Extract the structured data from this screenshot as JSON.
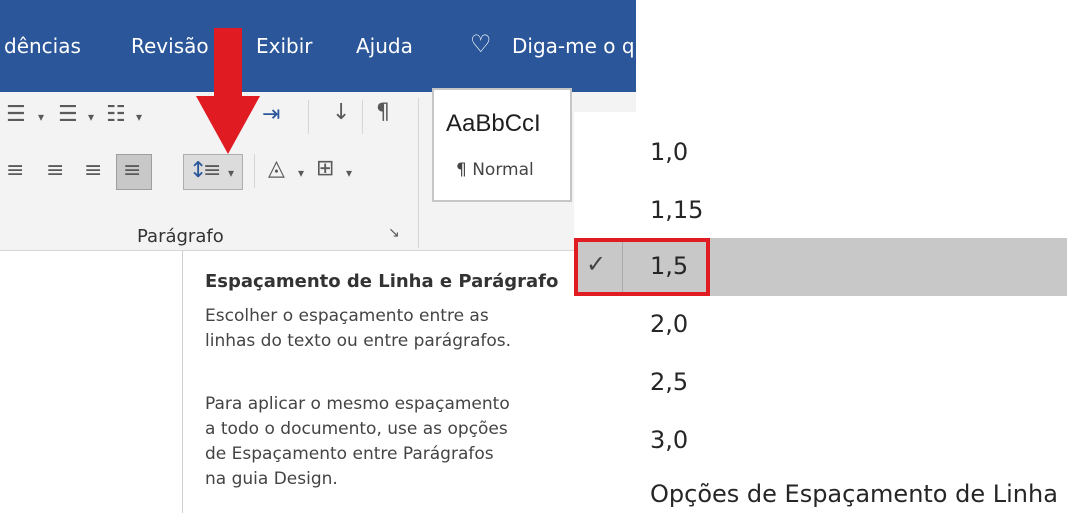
{
  "tabs": [
    "dências",
    "Revisão",
    "Exibir",
    "Ajuda",
    "Diga-me o q"
  ],
  "ribbon": {
    "group_label": "Parágrafo",
    "style_sample": "AaBbCcI",
    "style_name": "¶ Normal"
  },
  "tooltip": {
    "title": "Espaçamento de Linha e Parágrafo",
    "desc_lines": [
      "Escolher o espaçamento entre as",
      "linhas do texto ou entre parágrafos."
    ],
    "detail_lines": [
      "Para aplicar o mesmo espaçamento",
      "a todo o documento, use as opções",
      "de Espaçamento entre Parágrafos",
      "na guia Design."
    ]
  },
  "menu": {
    "items": [
      "1,0",
      "1,15",
      "1,5",
      "2,0",
      "2,5",
      "3,0"
    ],
    "selected_index": 2,
    "options_label": "Opções de Espaçamento de Linha"
  },
  "colors": {
    "ribbon_blue": "#2b579a",
    "highlight_red": "#e01b22",
    "selected_bg": "#c8c8c8"
  }
}
